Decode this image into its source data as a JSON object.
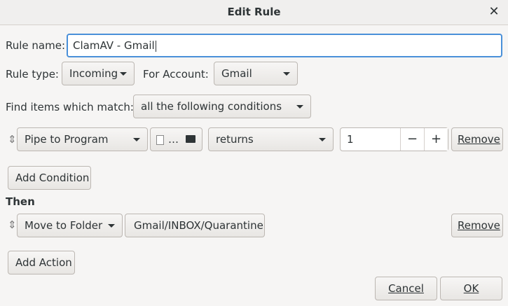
{
  "window": {
    "title": "Edit Rule"
  },
  "rule_name": {
    "label": "Rule name:",
    "value": "ClamAV - Gmail"
  },
  "rule_type": {
    "label": "Rule type:",
    "value": "Incoming"
  },
  "account": {
    "label": "For Account:",
    "value": "Gmail"
  },
  "match": {
    "label": "Find items which match:",
    "value": "all the following conditions"
  },
  "condition": {
    "type": "Pipe to Program",
    "program_ellipsis": "…",
    "comparison": "returns",
    "value": "1",
    "minus": "−",
    "plus": "+",
    "remove_label": "Remove"
  },
  "add_condition_label": "Add Condition",
  "then_label": "Then",
  "action": {
    "type": "Move to Folder",
    "folder": "Gmail/INBOX/Quarantine",
    "remove_label": "Remove"
  },
  "add_action_label": "Add Action",
  "footer": {
    "cancel_label": "Cancel",
    "ok_label": "OK"
  },
  "icons": {
    "close": "close-icon",
    "grip": "drag-handle-icon",
    "file": "file-icon",
    "folder_open": "folder-open-icon"
  },
  "colors": {
    "focus": "#4a90d9",
    "background": "#f6f5f4"
  }
}
